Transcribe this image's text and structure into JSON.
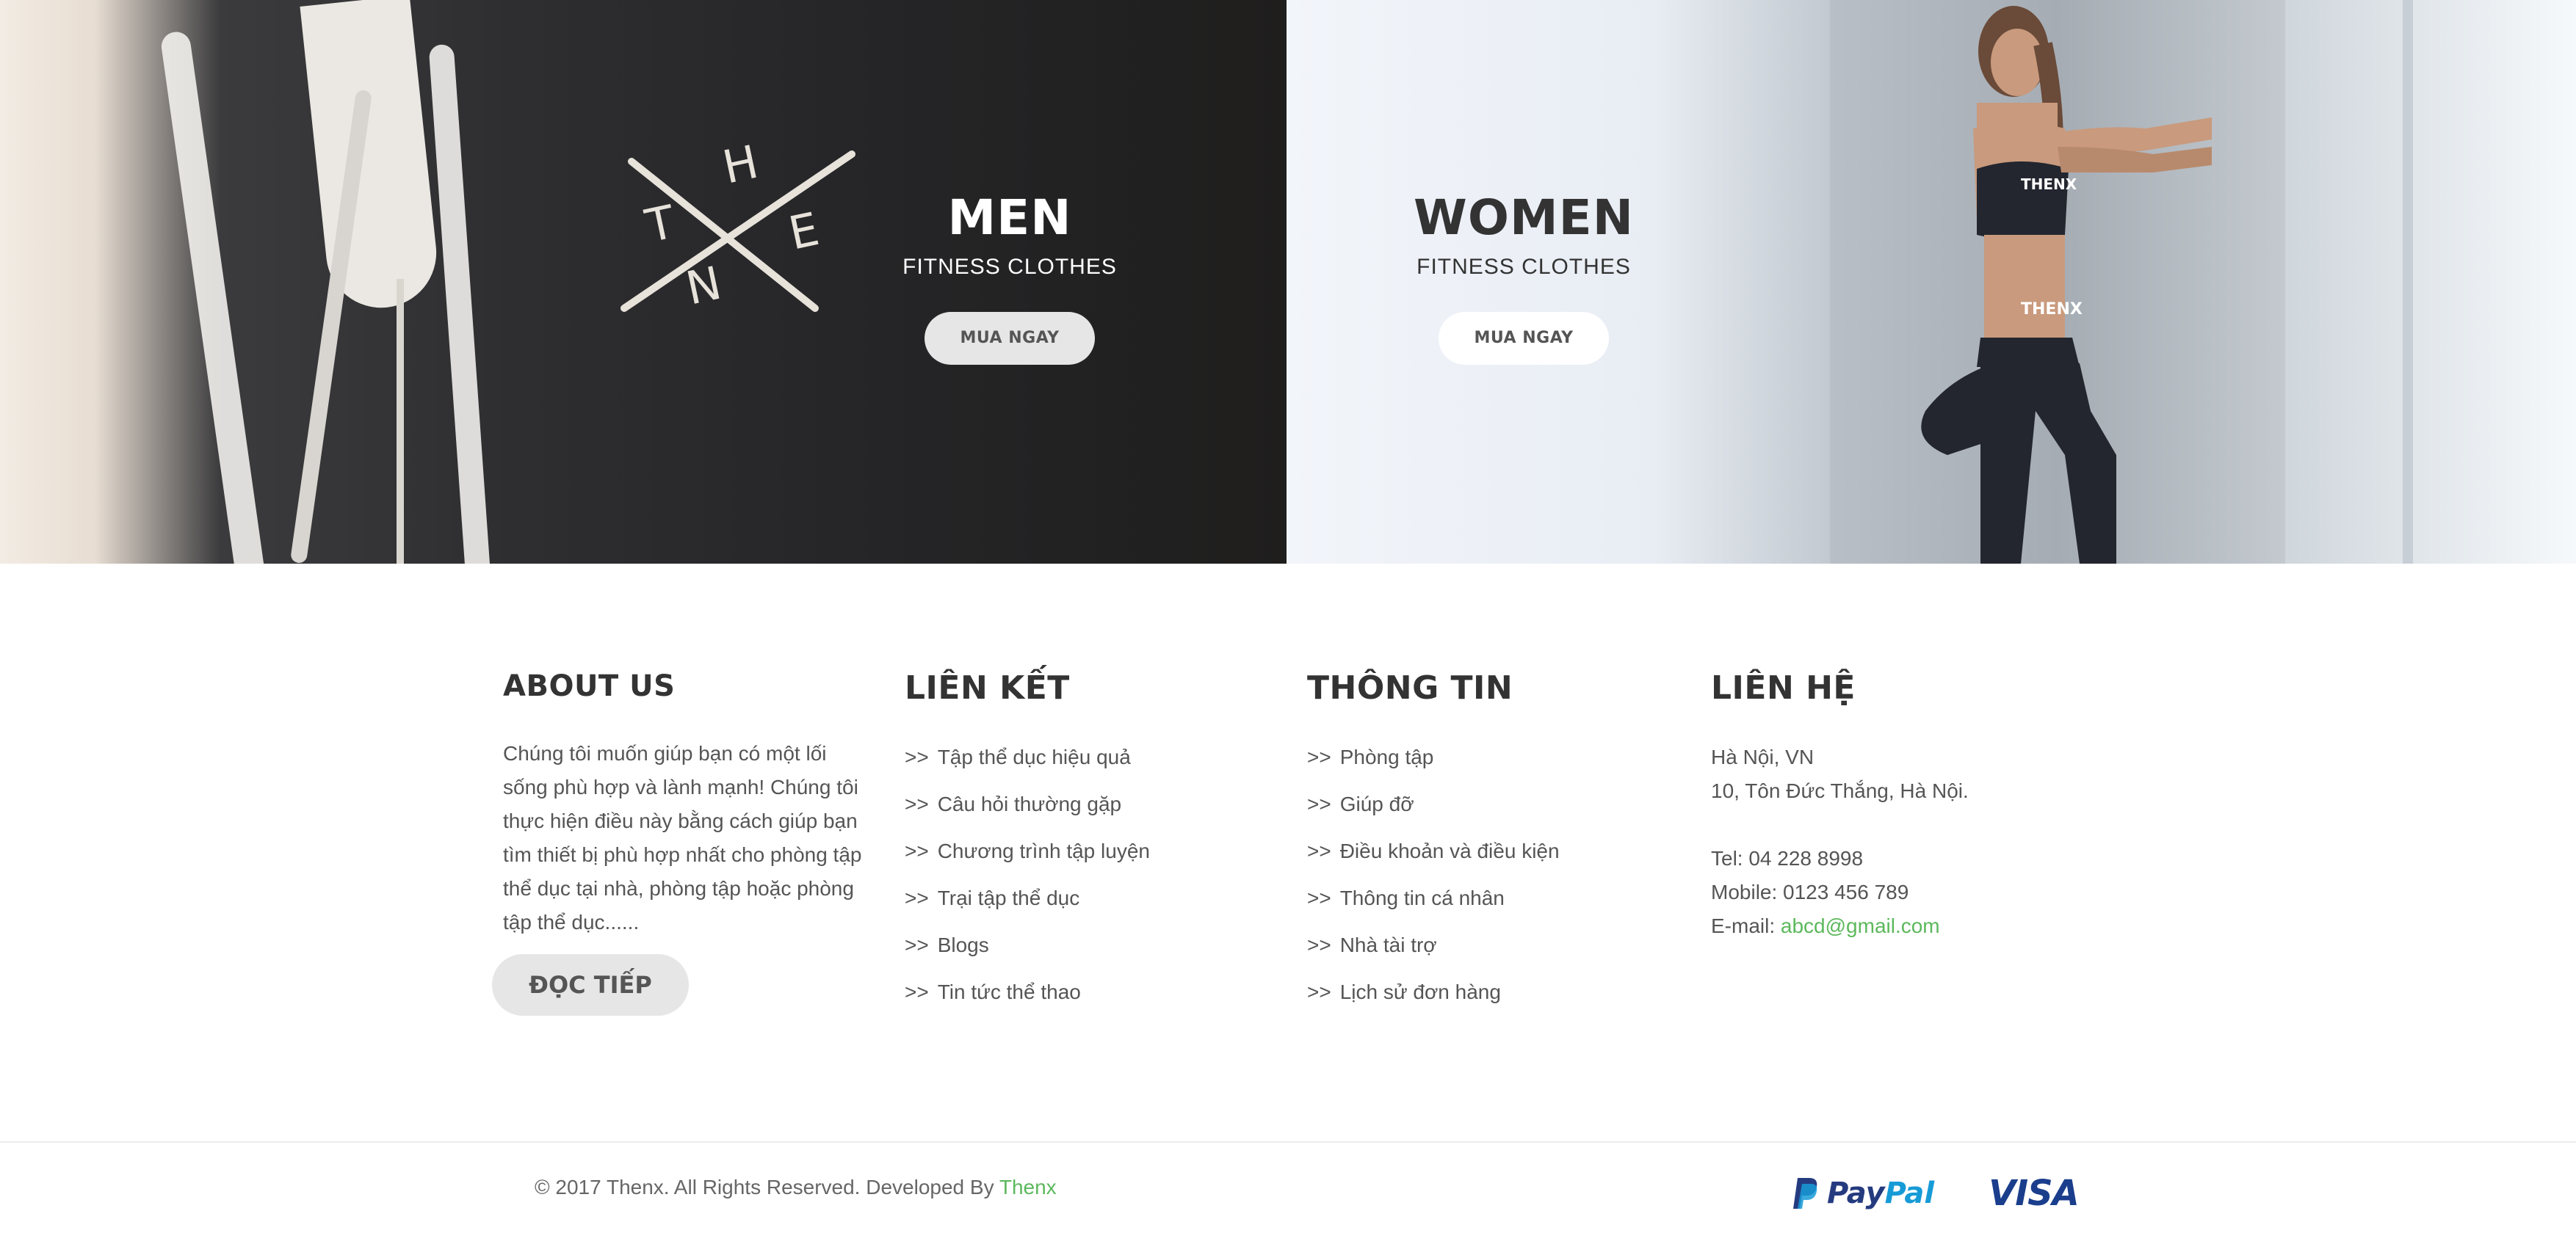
{
  "hero": {
    "men": {
      "title": "MEN",
      "subtitle": "FITNESS CLOTHES",
      "button": "MUA NGAY",
      "logo_letters": [
        "T",
        "H",
        "E",
        "N"
      ]
    },
    "women": {
      "title": "WOMEN",
      "subtitle": "FITNESS CLOTHES",
      "button": "MUA NGAY",
      "apparel_text": "THENX"
    }
  },
  "about": {
    "title": "ABOUT US",
    "text": "Chúng tôi muốn giúp bạn có một lối sống phù hợp và lành mạnh! Chúng tôi thực hiện điều này bằng cách giúp bạn tìm thiết bị phù hợp nhất cho phòng tập thể dục tại nhà, phòng tập hoặc phòng tập thể dục......",
    "read_more": "ĐỌC TIẾP"
  },
  "links": {
    "title": "LIÊN KẾT",
    "arrow": ">>",
    "items": [
      "Tập thể dục hiệu quả",
      "Câu hỏi thường gặp",
      "Chương trình tập luyện",
      "Trại tập thể dục",
      "Blogs",
      "Tin tức thể thao"
    ]
  },
  "info": {
    "title": "THÔNG TIN",
    "arrow": ">>",
    "items": [
      "Phòng tập",
      "Giúp đỡ",
      "Điều khoản và điều kiện",
      "Thông tin cá nhân",
      "Nhà tài trợ",
      "Lịch sử đơn hàng"
    ]
  },
  "contact": {
    "title": "LIÊN HỆ",
    "city": "Hà Nội, VN",
    "address": "10, Tôn Đức Thắng, Hà Nội.",
    "tel": "Tel: 04 228 8998",
    "mobile": "Mobile: 0123 456 789",
    "email_label": "E-mail: ",
    "email": "abcd@gmail.com"
  },
  "footer": {
    "copyright": "© 2017 Thenx. All Rights Reserved. Developed By ",
    "brand": "Thenx",
    "payments": {
      "paypal_pay": "Pay",
      "paypal_pal": "Pal",
      "visa": "VISA"
    }
  },
  "colors": {
    "accent_green": "#5cb85c",
    "paypal_blue": "#253b80",
    "paypal_light": "#179bd7",
    "visa_blue": "#1a3e8c"
  }
}
